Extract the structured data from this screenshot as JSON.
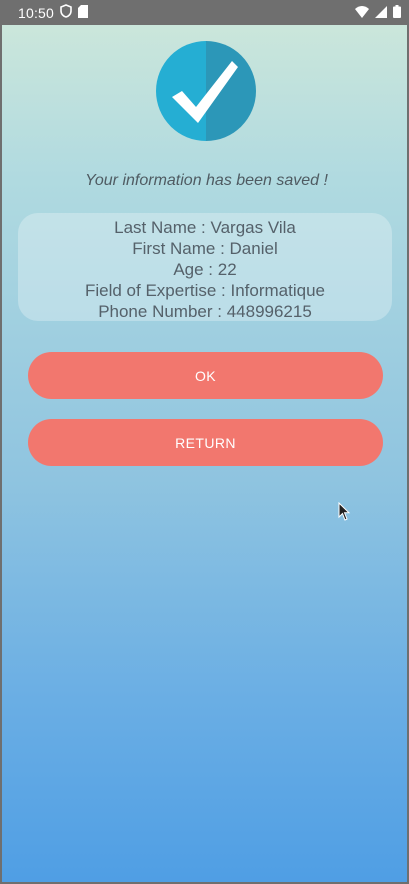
{
  "status_bar": {
    "time": "10:50",
    "icons": [
      "shield-icon",
      "sd-card-icon",
      "wifi-icon",
      "signal-icon",
      "battery-icon"
    ]
  },
  "header": {
    "icon": "checkmark-circle-icon",
    "accent_color": "#2baed4"
  },
  "message": "Your information has been saved !",
  "info": {
    "last_name": "Last Name : Vargas Vila",
    "first_name": "First Name : Daniel",
    "age": "Age : 22",
    "field": "Field of Expertise : Informatique",
    "phone": "Phone Number : 448996215"
  },
  "buttons": {
    "ok_label": "OK",
    "return_label": "RETURN",
    "color": "#f2776e"
  }
}
